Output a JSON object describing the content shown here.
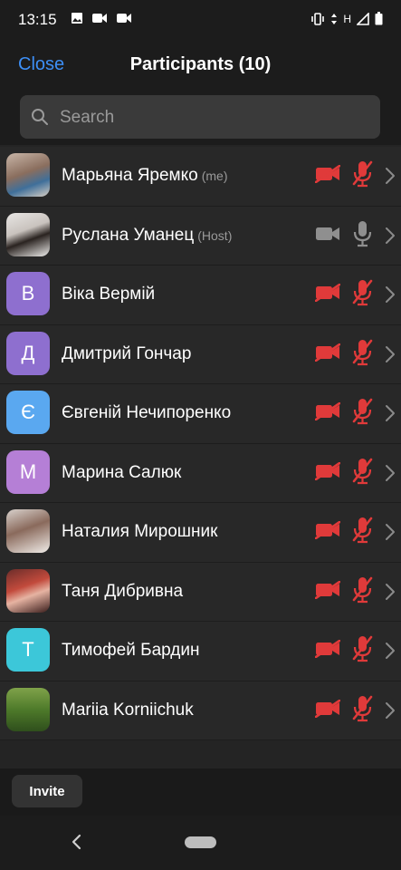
{
  "status_bar": {
    "time": "13:15",
    "network_label": "H"
  },
  "header": {
    "close_label": "Close",
    "title": "Participants (10)"
  },
  "search": {
    "placeholder": "Search"
  },
  "colors": {
    "accent": "#3d8ff6",
    "muted_red": "#e03a3a"
  },
  "participants": [
    {
      "name": "Марьяна Яремко",
      "tag": "(me)",
      "avatar": "photo",
      "video": "off",
      "audio": "muted"
    },
    {
      "name": "Руслана Уманец",
      "tag": "(Host)",
      "avatar": "photo",
      "video": "inactive",
      "audio": "inactive"
    },
    {
      "name": "Віка Вермій",
      "tag": "",
      "avatar": "В",
      "avatar_color": "#8e6fcf",
      "video": "off",
      "audio": "muted"
    },
    {
      "name": "Дмитрий Гончар",
      "tag": "",
      "avatar": "Д",
      "avatar_color": "#8e6fcf",
      "video": "off",
      "audio": "muted"
    },
    {
      "name": "Євгеній Нечипоренко",
      "tag": "",
      "avatar": "Є",
      "avatar_color": "#5aa8f0",
      "video": "off",
      "audio": "muted"
    },
    {
      "name": "Марина Салюк",
      "tag": "",
      "avatar": "М",
      "avatar_color": "#b57fd6",
      "video": "off",
      "audio": "muted"
    },
    {
      "name": "Наталия Мирошник",
      "tag": "",
      "avatar": "photo",
      "video": "off",
      "audio": "muted"
    },
    {
      "name": "Таня Дибривна",
      "tag": "",
      "avatar": "photo",
      "video": "off",
      "audio": "muted"
    },
    {
      "name": "Тимофей Бардин",
      "tag": "",
      "avatar": "Т",
      "avatar_color": "#3cc7d9",
      "video": "off",
      "audio": "muted"
    },
    {
      "name": "Mariia Korniichuk",
      "tag": "",
      "avatar": "photo",
      "video": "off",
      "audio": "muted"
    }
  ],
  "footer": {
    "invite_label": "Invite"
  }
}
